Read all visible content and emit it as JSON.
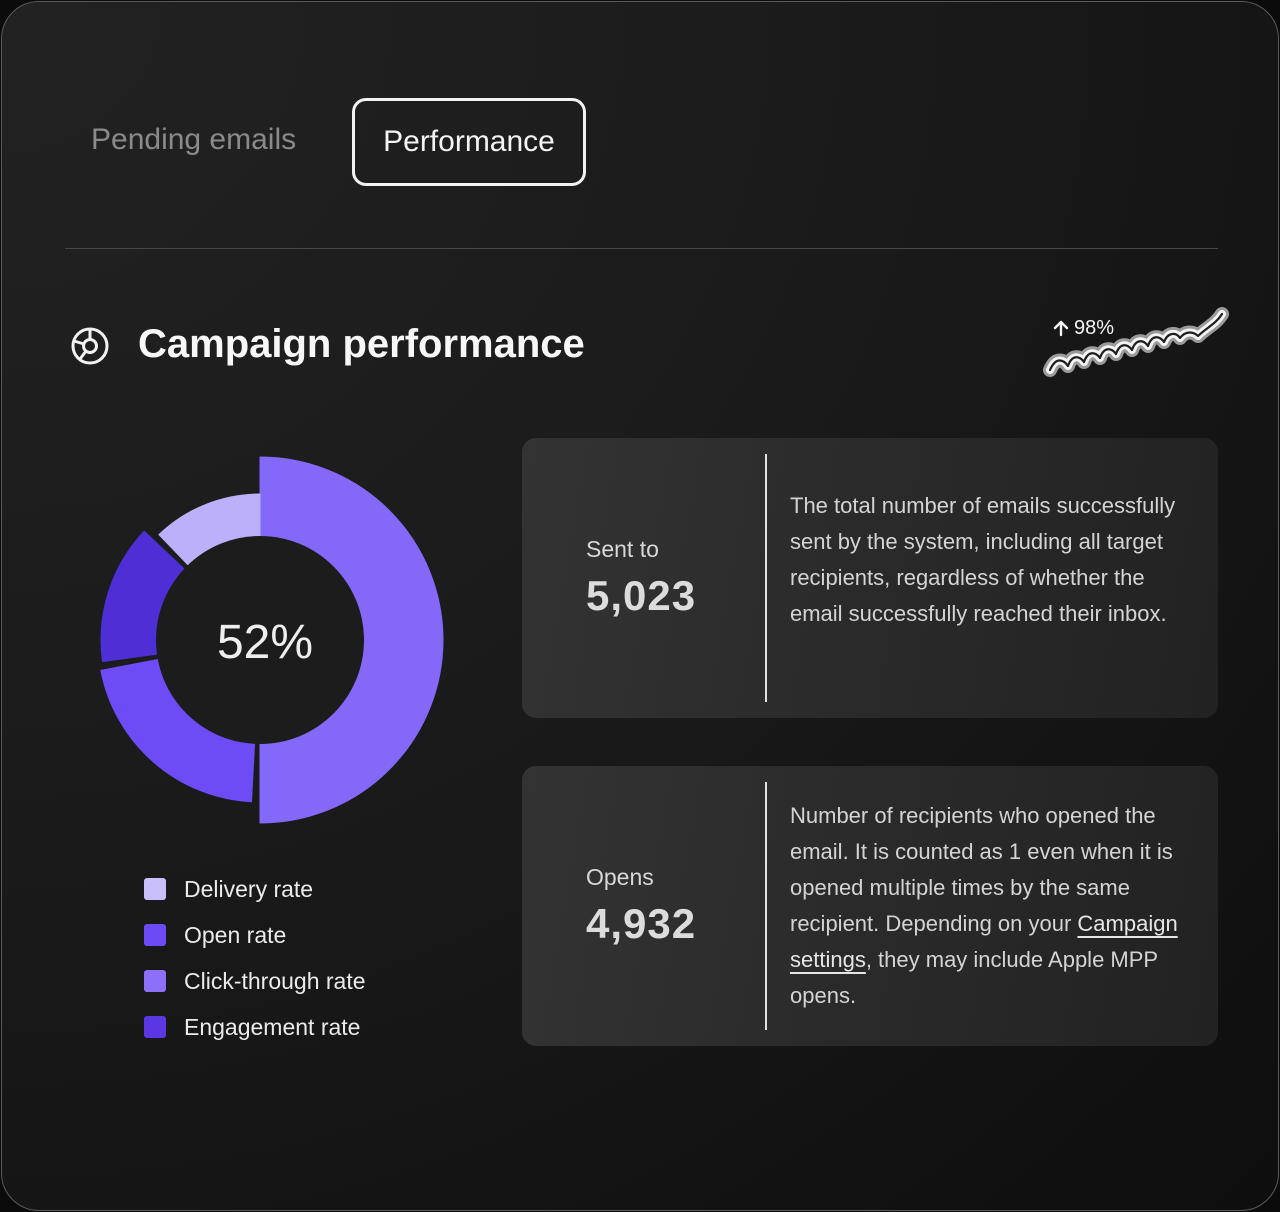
{
  "tabs": [
    {
      "label": "Pending emails",
      "active": false
    },
    {
      "label": "Performance",
      "active": true
    }
  ],
  "section": {
    "title": "Campaign performance",
    "icon": "pie-chart-icon"
  },
  "trend": {
    "label": "98%",
    "direction": "up",
    "icon": "arrow-up-icon"
  },
  "chart_data": {
    "type": "pie",
    "variant": "donut",
    "center_label": "52%",
    "legend": [
      {
        "label": "Delivery rate",
        "color": "#c9bffb"
      },
      {
        "label": "Open rate",
        "color": "#6a4bf6"
      },
      {
        "label": "Click-through rate",
        "color": "#8c70f7"
      },
      {
        "label": "Engagement rate",
        "color": "#5a37e3"
      }
    ],
    "slices": [
      {
        "name": "Click-through rate",
        "value": 50,
        "color": "#8468f8"
      },
      {
        "name": "Open rate",
        "value": 22,
        "color": "#6d4cf5"
      },
      {
        "name": "Engagement rate",
        "value": 15,
        "color": "#4e2fd6"
      },
      {
        "name": "Delivery rate",
        "value": 13,
        "color": "#bdb0fb"
      }
    ]
  },
  "stats": [
    {
      "label": "Sent to",
      "value": "5,023",
      "description": "The total number of emails successfully sent by the system, including all target recipients, regardless of whether the email successfully reached their inbox."
    },
    {
      "label": "Opens",
      "value": "4,932",
      "description_before": "Number of recipients who opened the email. It is counted as 1 even when it is opened multiple times by the same recipient. Depending on your ",
      "description_link": "Campaign settings",
      "description_after": ", they may include Apple MPP opens."
    }
  ]
}
